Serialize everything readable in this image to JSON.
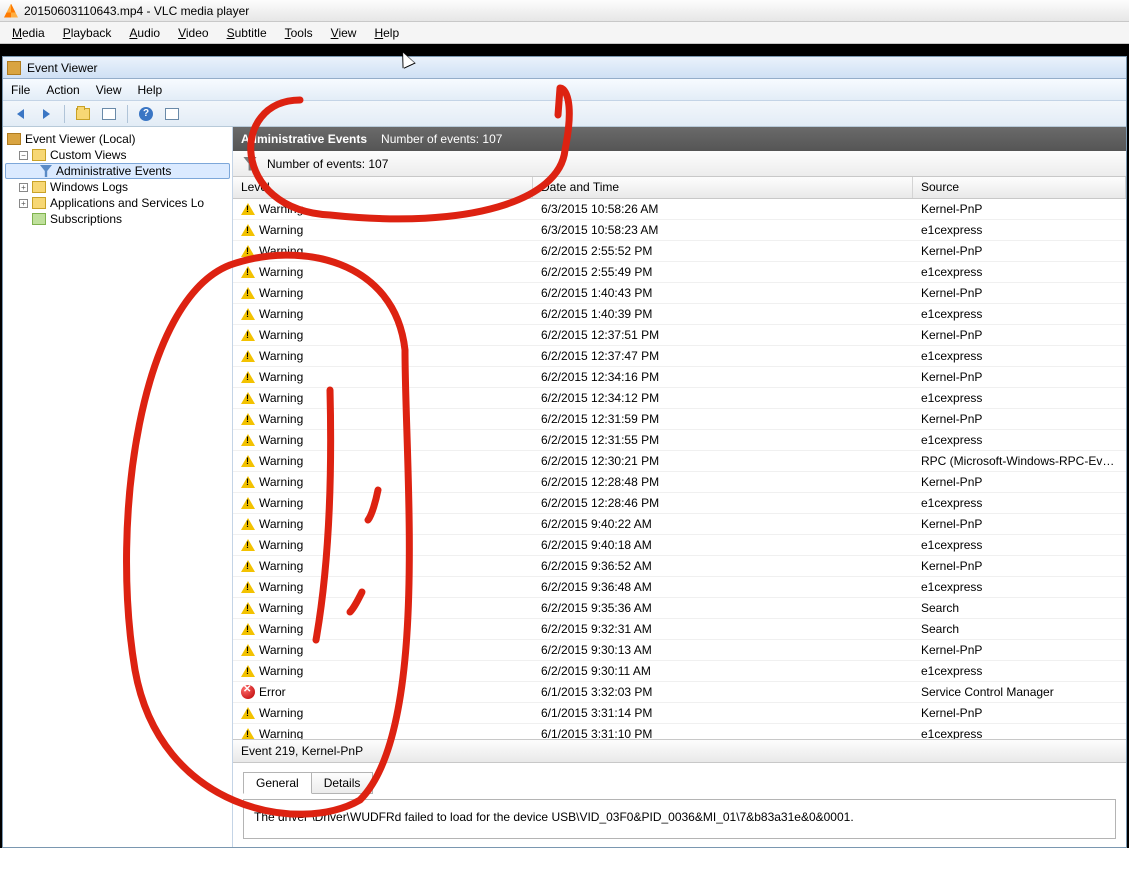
{
  "vlc": {
    "title": "20150603110643.mp4 - VLC media player",
    "menu": [
      "Media",
      "Playback",
      "Audio",
      "Video",
      "Subtitle",
      "Tools",
      "View",
      "Help"
    ]
  },
  "ev": {
    "title": "Event Viewer",
    "menu": [
      "File",
      "Action",
      "View",
      "Help"
    ],
    "tree": {
      "root": "Event Viewer (Local)",
      "custom_views": "Custom Views",
      "admin_events": "Administrative Events",
      "windows_logs": "Windows Logs",
      "apps_logs": "Applications and Services Lo",
      "subscriptions": "Subscriptions"
    },
    "main_title": "Administrative Events",
    "event_count_label": "Number of events: 107",
    "columns": {
      "level": "Level",
      "date": "Date and Time",
      "source": "Source"
    },
    "events": [
      {
        "level": "Warning",
        "date": "6/3/2015 10:58:26 AM",
        "source": "Kernel-PnP"
      },
      {
        "level": "Warning",
        "date": "6/3/2015 10:58:23 AM",
        "source": "e1cexpress"
      },
      {
        "level": "Warning",
        "date": "6/2/2015 2:55:52 PM",
        "source": "Kernel-PnP"
      },
      {
        "level": "Warning",
        "date": "6/2/2015 2:55:49 PM",
        "source": "e1cexpress"
      },
      {
        "level": "Warning",
        "date": "6/2/2015 1:40:43 PM",
        "source": "Kernel-PnP"
      },
      {
        "level": "Warning",
        "date": "6/2/2015 1:40:39 PM",
        "source": "e1cexpress"
      },
      {
        "level": "Warning",
        "date": "6/2/2015 12:37:51 PM",
        "source": "Kernel-PnP"
      },
      {
        "level": "Warning",
        "date": "6/2/2015 12:37:47 PM",
        "source": "e1cexpress"
      },
      {
        "level": "Warning",
        "date": "6/2/2015 12:34:16 PM",
        "source": "Kernel-PnP"
      },
      {
        "level": "Warning",
        "date": "6/2/2015 12:34:12 PM",
        "source": "e1cexpress"
      },
      {
        "level": "Warning",
        "date": "6/2/2015 12:31:59 PM",
        "source": "Kernel-PnP"
      },
      {
        "level": "Warning",
        "date": "6/2/2015 12:31:55 PM",
        "source": "e1cexpress"
      },
      {
        "level": "Warning",
        "date": "6/2/2015 12:30:21 PM",
        "source": "RPC (Microsoft-Windows-RPC-Events)"
      },
      {
        "level": "Warning",
        "date": "6/2/2015 12:28:48 PM",
        "source": "Kernel-PnP"
      },
      {
        "level": "Warning",
        "date": "6/2/2015 12:28:46 PM",
        "source": "e1cexpress"
      },
      {
        "level": "Warning",
        "date": "6/2/2015 9:40:22 AM",
        "source": "Kernel-PnP"
      },
      {
        "level": "Warning",
        "date": "6/2/2015 9:40:18 AM",
        "source": "e1cexpress"
      },
      {
        "level": "Warning",
        "date": "6/2/2015 9:36:52 AM",
        "source": "Kernel-PnP"
      },
      {
        "level": "Warning",
        "date": "6/2/2015 9:36:48 AM",
        "source": "e1cexpress"
      },
      {
        "level": "Warning",
        "date": "6/2/2015 9:35:36 AM",
        "source": "Search"
      },
      {
        "level": "Warning",
        "date": "6/2/2015 9:32:31 AM",
        "source": "Search"
      },
      {
        "level": "Warning",
        "date": "6/2/2015 9:30:13 AM",
        "source": "Kernel-PnP"
      },
      {
        "level": "Warning",
        "date": "6/2/2015 9:30:11 AM",
        "source": "e1cexpress"
      },
      {
        "level": "Error",
        "date": "6/1/2015 3:32:03 PM",
        "source": "Service Control Manager"
      },
      {
        "level": "Warning",
        "date": "6/1/2015 3:31:14 PM",
        "source": "Kernel-PnP"
      },
      {
        "level": "Warning",
        "date": "6/1/2015 3:31:10 PM",
        "source": "e1cexpress"
      }
    ],
    "detail": {
      "header": "Event 219, Kernel-PnP",
      "tabs": {
        "general": "General",
        "details": "Details"
      },
      "message": "The driver \\Driver\\WUDFRd failed to load for the device USB\\VID_03F0&PID_0036&MI_01\\7&b83a31e&0&0001."
    }
  }
}
